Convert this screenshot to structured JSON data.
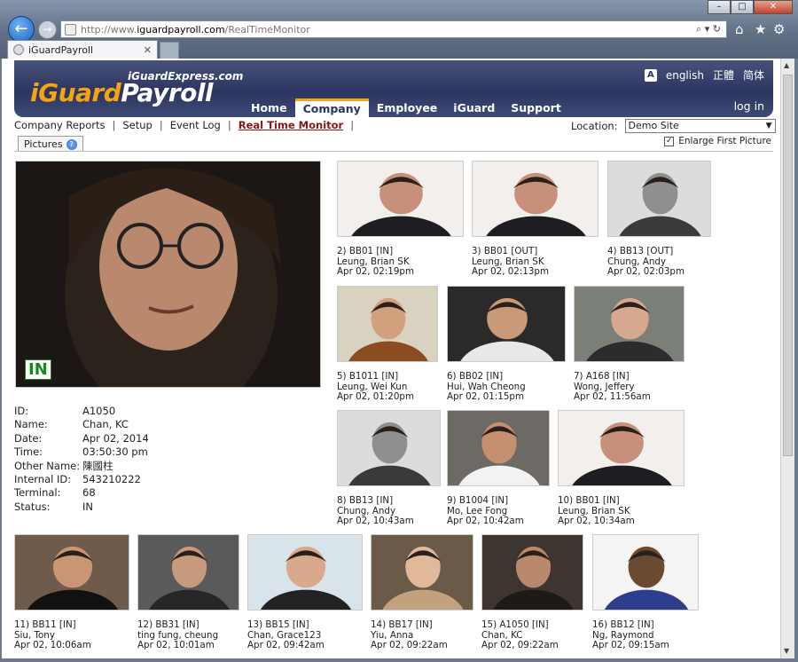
{
  "browser": {
    "url_prefix": "http://www.",
    "url_host": "iguardpayroll.com",
    "url_path": "/RealTimeMonitor",
    "tab_title": "iGuardPayroll",
    "window_buttons": [
      "–",
      "□",
      "✕"
    ]
  },
  "site": {
    "brand_sub": "iGuardExpress.com",
    "brand_i": "iGuard",
    "brand_rest": "Payroll",
    "languages": [
      "english",
      "正體",
      "简体"
    ],
    "menu": [
      "Home",
      "Company",
      "Employee",
      "iGuard",
      "Support"
    ],
    "active_menu": "Company",
    "login": "log in"
  },
  "subnav": {
    "items": [
      "Company Reports",
      "Setup",
      "Event Log",
      "Real Time Monitor"
    ],
    "location_label": "Location:",
    "location_value": "Demo Site",
    "pictures_tab": "Pictures",
    "enlarge_label": "Enlarge First Picture"
  },
  "featured": {
    "status_stamp": "IN",
    "fields": [
      {
        "k": "ID:",
        "v": "A1050"
      },
      {
        "k": "Name:",
        "v": "Chan, KC"
      },
      {
        "k": "Date:",
        "v": "Apr 02, 2014"
      },
      {
        "k": "Time:",
        "v": "03:50:30 pm"
      },
      {
        "k": "Other Name:",
        "v": "陳國柱"
      },
      {
        "k": "Internal ID:",
        "v": "543210222"
      },
      {
        "k": "Terminal:",
        "v": "68"
      },
      {
        "k": "Status:",
        "v": "IN"
      }
    ]
  },
  "events": [
    {
      "line1": "2) BB01 [IN]",
      "name": "Leung, Brian SK",
      "time": "Apr 02, 02:19pm"
    },
    {
      "line1": "3) BB01 [OUT]",
      "name": "Leung, Brian SK",
      "time": "Apr 02, 02:13pm"
    },
    {
      "line1": "4) BB13 [OUT]",
      "name": "Chung, Andy",
      "time": "Apr 02, 02:03pm"
    },
    {
      "line1": "5) B1011 [IN]",
      "name": "Leung, Wei Kun",
      "time": "Apr 02, 01:20pm"
    },
    {
      "line1": "6) BB02 [IN]",
      "name": "Hui, Wah Cheong",
      "time": "Apr 02, 01:15pm"
    },
    {
      "line1": "7) A168 [IN]",
      "name": "Wong, Jeffery",
      "time": "Apr 02, 11:56am"
    },
    {
      "line1": "8) BB13 [IN]",
      "name": "Chung, Andy",
      "time": "Apr 02, 10:43am"
    },
    {
      "line1": "9) B1004 [IN]",
      "name": "Mo, Lee Fong",
      "time": "Apr 02, 10:42am"
    },
    {
      "line1": "10) BB01 [IN]",
      "name": "Leung, Brian SK",
      "time": "Apr 02, 10:34am"
    },
    {
      "line1": "11) BB11 [IN]",
      "name": "Siu, Tony",
      "time": "Apr 02, 10:06am"
    },
    {
      "line1": "12) BB31 [IN]",
      "name": "ting fung, cheung",
      "time": "Apr 02, 10:01am"
    },
    {
      "line1": "13) BB15 [IN]",
      "name": "Chan, Grace123",
      "time": "Apr 02, 09:42am"
    },
    {
      "line1": "14) BB17 [IN]",
      "name": "Yiu, Anna",
      "time": "Apr 02, 09:22am"
    },
    {
      "line1": "15) A1050 [IN]",
      "name": "Chan, KC",
      "time": "Apr 02, 09:22am"
    },
    {
      "line1": "16) BB12 [IN]",
      "name": "Ng, Raymond",
      "time": "Apr 02, 09:15am"
    }
  ],
  "colors": {
    "accent": "#f6a411",
    "banner": "#2c3560",
    "active_link": "#8b1414",
    "in_stamp": "#138a1d"
  }
}
